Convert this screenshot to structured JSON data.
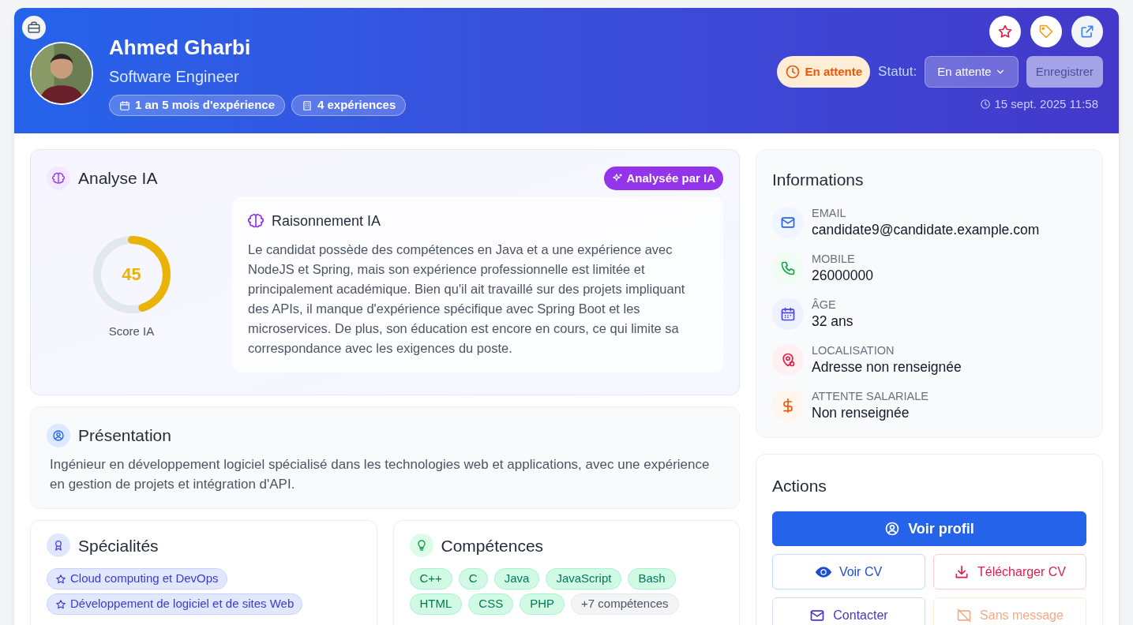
{
  "header": {
    "name": "Ahmed Gharbi",
    "title": "Software Engineer",
    "chips": [
      {
        "kind": "calendar",
        "label": "1 an 5 mois d'expérience"
      },
      {
        "kind": "building",
        "label": "4 expériences"
      }
    ],
    "status_badge": "En attente",
    "status_label": "Statut:",
    "status_select": "En attente",
    "save_button": {
      "label": "Enregistrer",
      "disabled": true
    },
    "date": "15 sept. 2025 11:58"
  },
  "analysis": {
    "title": "Analyse IA",
    "badge": "Analysée par IA",
    "score": "45",
    "level": 0.45,
    "score_label": "Score IA",
    "reasoning_title": "Raisonnement IA",
    "reasoning": "Le candidat possède des compétences en Java et a une expérience avec NodeJS et Spring, mais son expérience professionnelle est limitée et principalement académique. Bien qu'il ait travaillé sur des projets impliquant des APIs, il manque d'expérience spécifique avec Spring Boot et les microservices. De plus, son éducation est encore en cours, ce qui limite sa correspondance avec les exigences du poste."
  },
  "presentation": {
    "title": "Présentation",
    "text": "Ingénieur en développement logiciel spécialisé dans les technologies web et applications, avec une expérience en gestion de projets et intégration d'API."
  },
  "specialties": {
    "title": "Spécialités",
    "items": [
      "Cloud computing et DevOps",
      "Développement de logiciel et de sites Web"
    ]
  },
  "skills": {
    "title": "Compétences",
    "items": [
      {
        "kind": "skill",
        "label": "C++"
      },
      {
        "kind": "skill",
        "label": "C"
      },
      {
        "kind": "skill",
        "label": "Java"
      },
      {
        "kind": "skill",
        "label": "JavaScript"
      },
      {
        "kind": "skill",
        "label": "Bash"
      },
      {
        "kind": "skill",
        "label": "HTML"
      },
      {
        "kind": "skill",
        "label": "CSS"
      },
      {
        "kind": "skill",
        "label": "PHP"
      },
      {
        "kind": "more",
        "label": "+7 compétences"
      }
    ]
  },
  "informations": {
    "title": "Informations",
    "items": [
      {
        "kind": "email",
        "label": "EMAIL",
        "value": "candidate9@candidate.example.com"
      },
      {
        "kind": "phone",
        "label": "MOBILE",
        "value": "26000000"
      },
      {
        "kind": "age",
        "label": "ÂGE",
        "value": "32 ans"
      },
      {
        "kind": "location",
        "label": "LOCALISATION",
        "value": "Adresse non renseignée"
      },
      {
        "kind": "salary",
        "label": "ATTENTE SALARIALE",
        "value": "Non renseignée"
      }
    ]
  },
  "actions": {
    "title": "Actions",
    "buttons": [
      {
        "kind": "primary",
        "label": "Voir profil",
        "disabled": false
      },
      {
        "kind": "view",
        "label": "Voir CV",
        "disabled": false
      },
      {
        "kind": "download",
        "label": "Télécharger CV",
        "disabled": false
      },
      {
        "kind": "contact",
        "label": "Contacter",
        "disabled": false
      },
      {
        "kind": "nomessage",
        "label": "Sans message",
        "disabled": true
      }
    ]
  }
}
